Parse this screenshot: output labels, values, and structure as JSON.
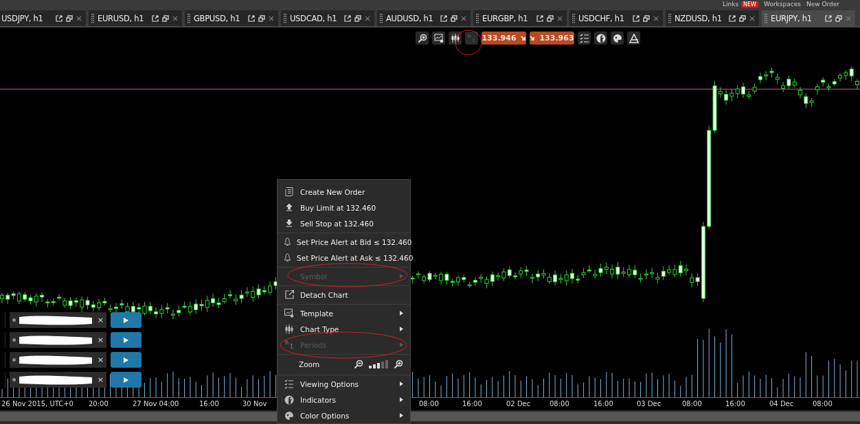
{
  "header_links": [
    {
      "label": "Links",
      "badge": "NEW"
    },
    {
      "label": "Workspaces"
    },
    {
      "label": "New Order"
    }
  ],
  "tabs": [
    {
      "label": "USDJPY, h1",
      "selected": false
    },
    {
      "label": "EURUSD, h1",
      "selected": false
    },
    {
      "label": "GBPUSD, h1",
      "selected": false
    },
    {
      "label": "USDCAD, h1",
      "selected": false
    },
    {
      "label": "AUDUSD, h1",
      "selected": false
    },
    {
      "label": "EURGBP, h1",
      "selected": false
    },
    {
      "label": "USDCHF, h1",
      "selected": false
    },
    {
      "label": "NZDUSD, h1",
      "selected": false
    },
    {
      "label": "EURJPY, h1",
      "selected": true
    }
  ],
  "toolbar": {
    "period_letter": "h",
    "period_number": "1",
    "bid": "133.946",
    "ask": "133.963"
  },
  "quick_orders": [
    {
      "close": "×"
    },
    {
      "close": "×"
    },
    {
      "close": "×"
    },
    {
      "close": "×"
    }
  ],
  "time_axis": [
    "26 Nov 2015, UTC+0",
    "20:00",
    "27 Nov 04:00",
    "16:00",
    "30 Nov",
    "08:00",
    "16:00",
    "02 Dec",
    "08:00",
    "16:00",
    "03 Dec",
    "08:00",
    "16:00",
    "04 Dec",
    "08:00"
  ],
  "context_menu": [
    {
      "kind": "item",
      "label": "Create New Order",
      "disabled": false,
      "submenu": false
    },
    {
      "kind": "item",
      "label": "Buy Limit at 132.460",
      "disabled": false,
      "submenu": false
    },
    {
      "kind": "item",
      "label": "Sell Stop at 132.460",
      "disabled": false,
      "submenu": false
    },
    {
      "kind": "separator"
    },
    {
      "kind": "item",
      "label": "Set Price Alert at Bid ≤ 132.460",
      "disabled": false,
      "submenu": false
    },
    {
      "kind": "item",
      "label": "Set Price Alert at Ask ≤ 132.460",
      "disabled": false,
      "submenu": false
    },
    {
      "kind": "separator"
    },
    {
      "kind": "item",
      "label": "Symbol",
      "disabled": true,
      "submenu": true
    },
    {
      "kind": "separator"
    },
    {
      "kind": "item",
      "label": "Detach Chart",
      "disabled": false,
      "submenu": false
    },
    {
      "kind": "separator"
    },
    {
      "kind": "item",
      "label": "Template",
      "disabled": false,
      "submenu": true
    },
    {
      "kind": "item",
      "label": "Chart Type",
      "disabled": false,
      "submenu": true
    },
    {
      "kind": "period",
      "label": "Periods",
      "letter": "h",
      "number": "1",
      "disabled": true,
      "submenu": true
    },
    {
      "kind": "separator"
    },
    {
      "kind": "zoom",
      "label": "Zoom",
      "level": 0.6
    },
    {
      "kind": "separator"
    },
    {
      "kind": "item",
      "label": "Viewing Options",
      "disabled": false,
      "submenu": true
    },
    {
      "kind": "item",
      "label": "Indicators",
      "disabled": false,
      "submenu": true
    },
    {
      "kind": "item",
      "label": "Color Options",
      "disabled": false,
      "submenu": true
    }
  ],
  "annotations": [
    {
      "kind": "ellipse"
    },
    {
      "kind": "ellipse"
    },
    {
      "kind": "ellipse"
    }
  ]
}
